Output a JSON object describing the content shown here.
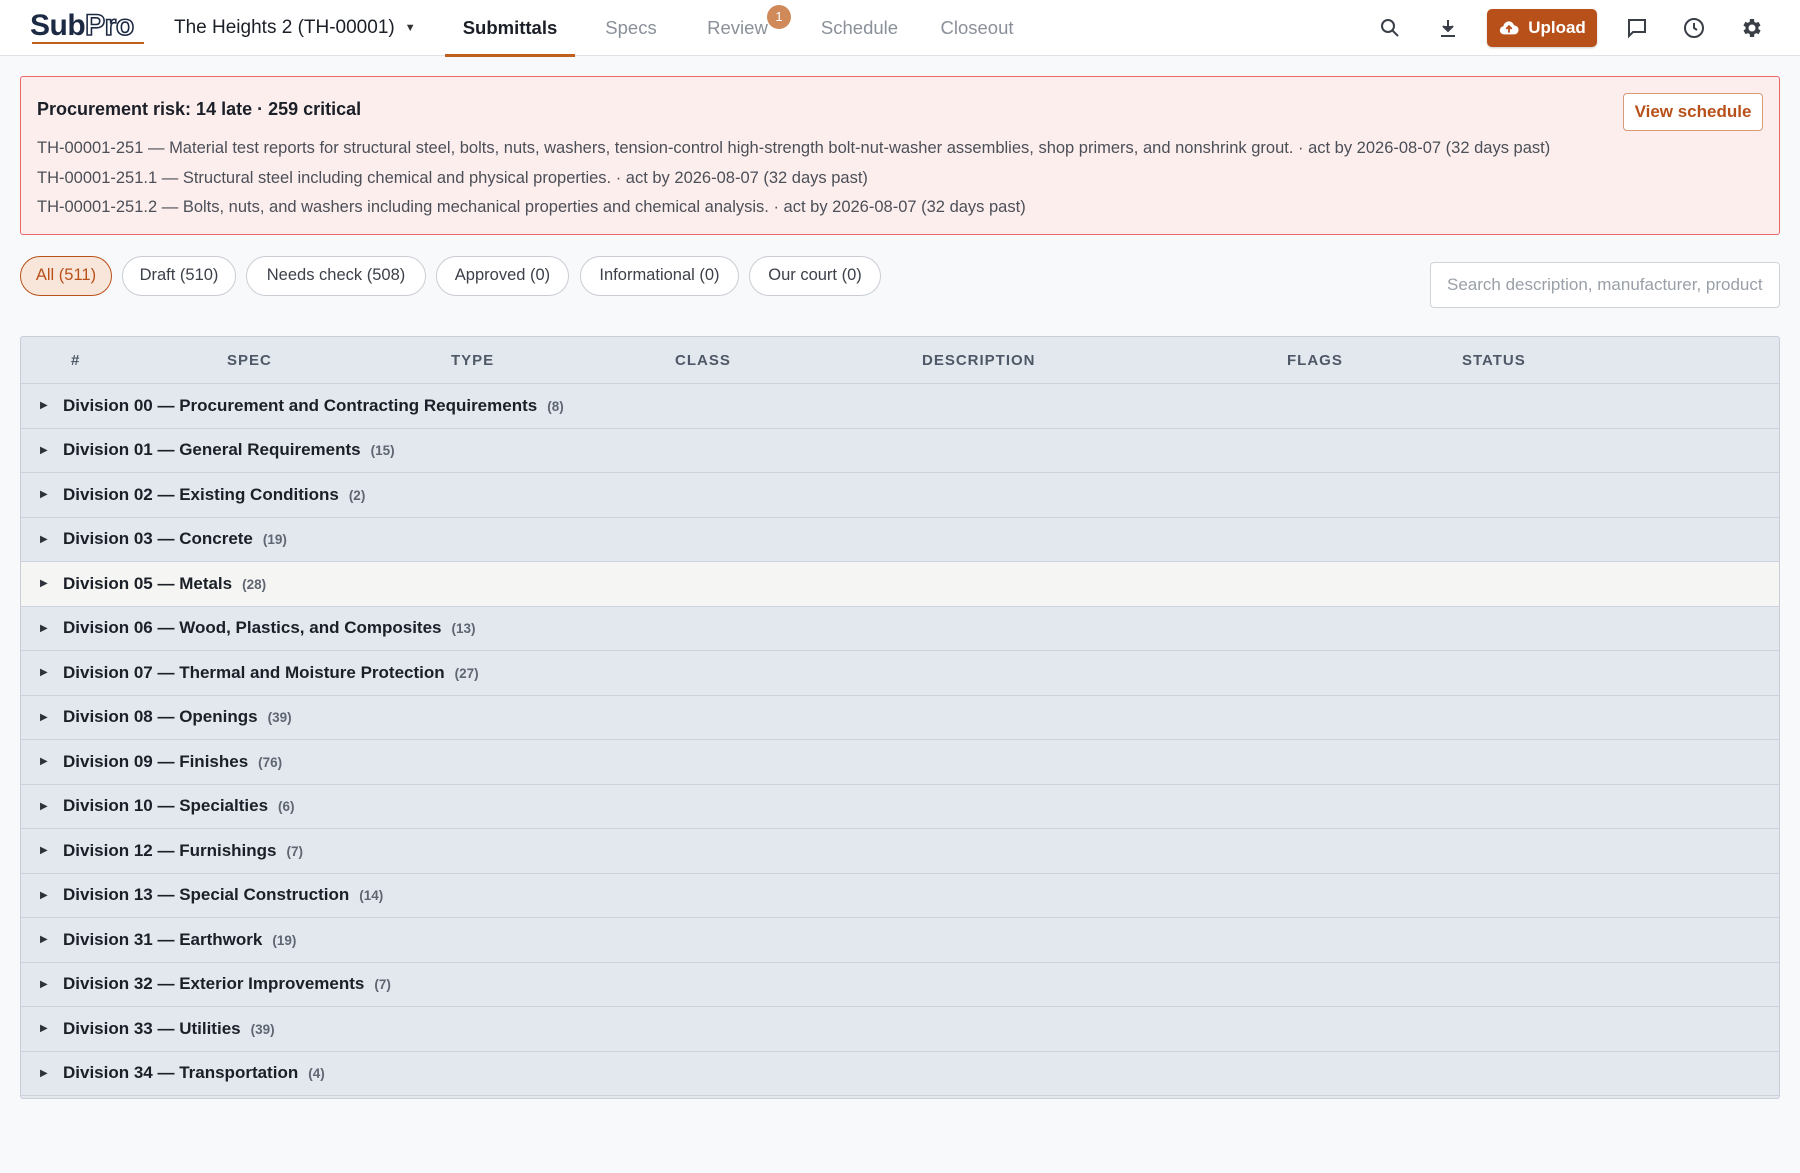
{
  "app": {
    "logo_sub": "Sub",
    "logo_pro": "Pro"
  },
  "project": {
    "name": "The Heights 2 (TH-00001)"
  },
  "tabs": [
    {
      "label": "Submittals",
      "active": true
    },
    {
      "label": "Specs"
    },
    {
      "label": "Review",
      "badge": "1"
    },
    {
      "label": "Schedule"
    },
    {
      "label": "Closeout"
    }
  ],
  "toolbar": {
    "upload_label": "Upload",
    "icons": [
      "search-icon",
      "download-icon",
      "upload-cloud-icon",
      "comment-icon",
      "history-icon",
      "settings-icon"
    ]
  },
  "alert": {
    "title": "Procurement risk: 14 late · 259 critical",
    "button": "View schedule",
    "lines": [
      "TH-00001-251 — Material test reports for structural steel, bolts, nuts, washers, tension-control high-strength bolt-nut-washer assemblies, shop primers, and nonshrink grout. · act by 2026-08-07 (32 days past)",
      "TH-00001-251.1 — Structural steel including chemical and physical properties. · act by 2026-08-07 (32 days past)",
      "TH-00001-251.2 — Bolts, nuts, and washers including mechanical properties and chemical analysis. · act by 2026-08-07 (32 days past)"
    ]
  },
  "filters": [
    {
      "label": "All (511)",
      "active": true
    },
    {
      "label": "Draft (510)"
    },
    {
      "label": "Needs check (508)"
    },
    {
      "label": "Approved (0)"
    },
    {
      "label": "Informational (0)"
    },
    {
      "label": "Our court (0)"
    }
  ],
  "search": {
    "placeholder": "Search description, manufacturer, product"
  },
  "table": {
    "columns": [
      "#",
      "SPEC",
      "TYPE",
      "CLASS",
      "DESCRIPTION",
      "FLAGS",
      "STATUS"
    ],
    "groups": [
      {
        "name": "Division 00 — Procurement and Contracting Requirements",
        "count": "(8)"
      },
      {
        "name": "Division 01 — General Requirements",
        "count": "(15)"
      },
      {
        "name": "Division 02 — Existing Conditions",
        "count": "(2)"
      },
      {
        "name": "Division 03 — Concrete",
        "count": "(19)"
      },
      {
        "name": "Division 05 — Metals",
        "count": "(28)"
      },
      {
        "name": "Division 06 — Wood, Plastics, and Composites",
        "count": "(13)"
      },
      {
        "name": "Division 07 — Thermal and Moisture Protection",
        "count": "(27)"
      },
      {
        "name": "Division 08 — Openings",
        "count": "(39)"
      },
      {
        "name": "Division 09 — Finishes",
        "count": "(76)"
      },
      {
        "name": "Division 10 — Specialties",
        "count": "(6)"
      },
      {
        "name": "Division 12 — Furnishings",
        "count": "(7)"
      },
      {
        "name": "Division 13 — Special Construction",
        "count": "(14)"
      },
      {
        "name": "Division 31 — Earthwork",
        "count": "(19)"
      },
      {
        "name": "Division 32 — Exterior Improvements",
        "count": "(7)"
      },
      {
        "name": "Division 33 — Utilities",
        "count": "(39)"
      },
      {
        "name": "Division 34 — Transportation",
        "count": "(4)"
      }
    ]
  },
  "colors": {
    "accent": "#b8501a",
    "alert_border": "#e86a6a",
    "alert_bg": "#fdeeee",
    "table_bg": "#e3e8ef"
  }
}
